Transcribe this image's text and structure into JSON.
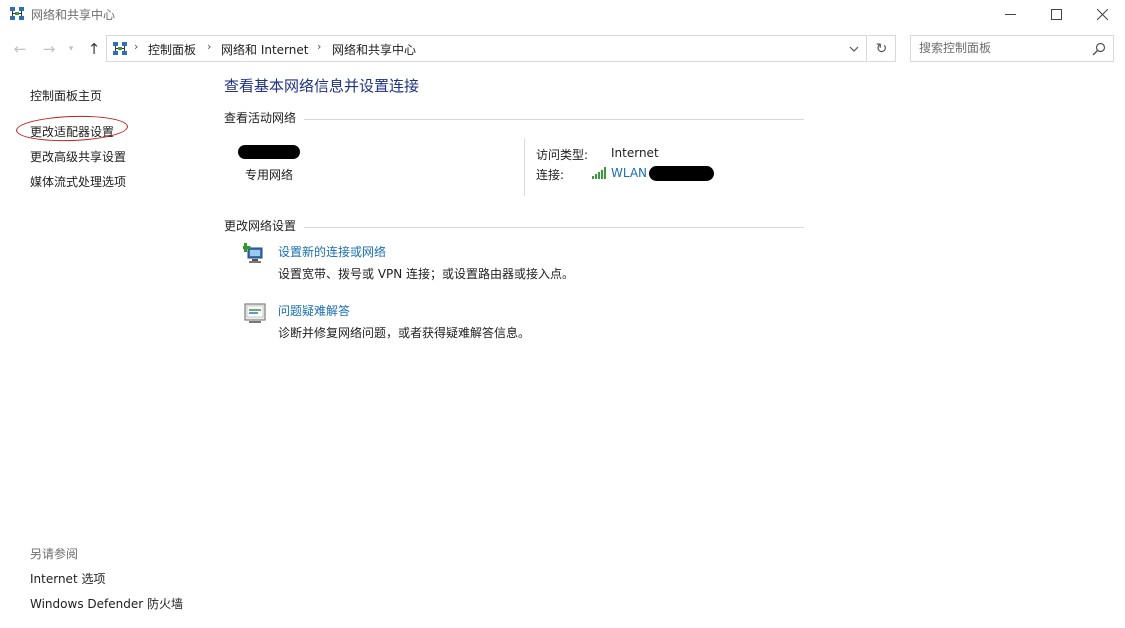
{
  "window": {
    "title": "网络和共享中心"
  },
  "address_bar": {
    "breadcrumbs": [
      "控制面板",
      "网络和 Internet",
      "网络和共享中心"
    ]
  },
  "search": {
    "placeholder": "搜索控制面板"
  },
  "left_pane": {
    "links": [
      "控制面板主页",
      "更改适配器设置",
      "更改高级共享设置",
      "媒体流式处理选项"
    ],
    "see_also_heading": "另请参阅",
    "see_also_links": [
      "Internet 选项",
      "Windows Defender 防火墙"
    ]
  },
  "main": {
    "title": "查看基本网络信息并设置连接",
    "active_networks_heading": "查看活动网络",
    "network": {
      "type": "专用网络",
      "access_type_label": "访问类型:",
      "access_type_value": "Internet",
      "connection_label": "连接:",
      "connection_value": "WLAN"
    },
    "change_settings_heading": "更改网络设置",
    "tasks": [
      {
        "link": "设置新的连接或网络",
        "description": "设置宽带、拨号或 VPN 连接；或设置路由器或接入点。"
      },
      {
        "link": "问题疑难解答",
        "description": "诊断并修复网络问题，或者获得疑难解答信息。"
      }
    ]
  },
  "colors": {
    "link": "#1a6fb5",
    "title": "#1e3287",
    "annotation": "#c41e1e"
  }
}
